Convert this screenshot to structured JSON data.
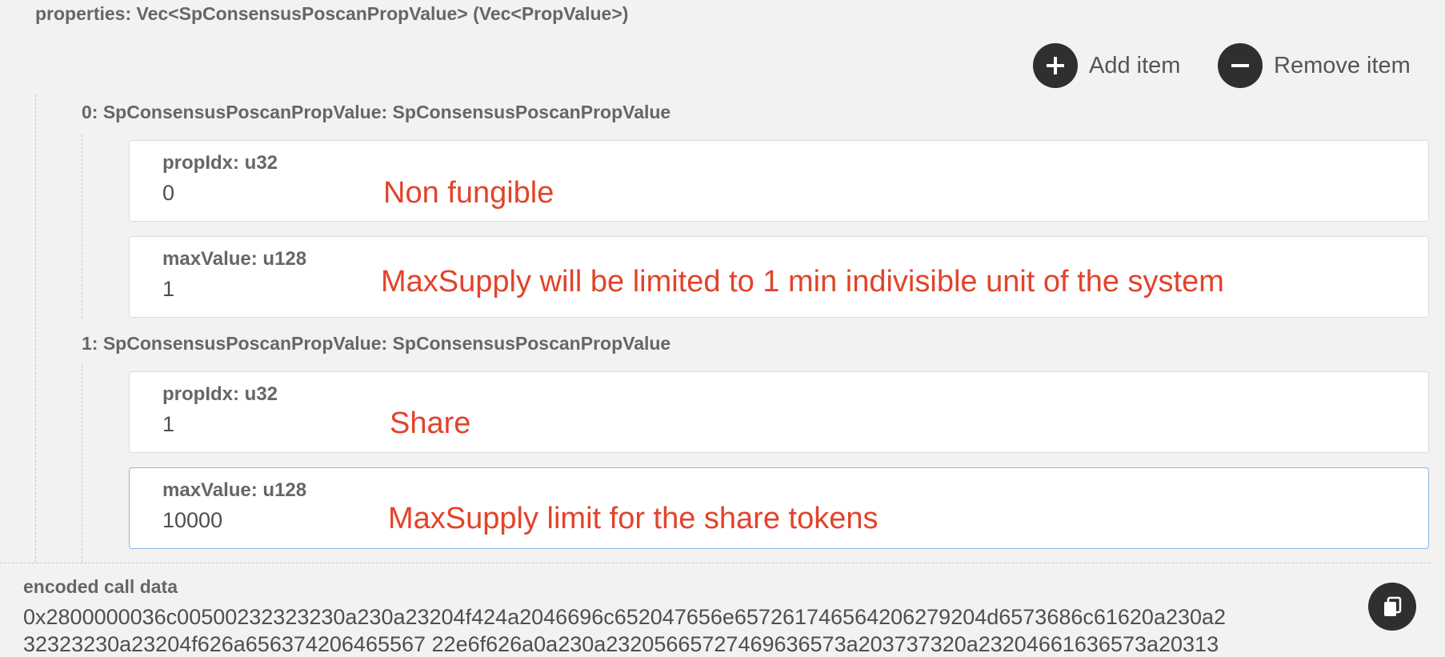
{
  "properties_label": "properties: Vec<SpConsensusPoscanPropValue> (Vec<PropValue>)",
  "buttons": {
    "add_item": "Add item",
    "remove_item": "Remove item"
  },
  "items": [
    {
      "header": "0: SpConsensusPoscanPropValue: SpConsensusPoscanPropValue",
      "prop_idx": {
        "label": "propIdx: u32",
        "value": "0",
        "note": "Non fungible"
      },
      "max_value": {
        "label": "maxValue: u128",
        "value": "1",
        "note": "MaxSupply will be limited to 1 min indivisible unit of the system"
      }
    },
    {
      "header": "1: SpConsensusPoscanPropValue: SpConsensusPoscanPropValue",
      "prop_idx": {
        "label": "propIdx: u32",
        "value": "1",
        "note": "Share"
      },
      "max_value": {
        "label": "maxValue: u128",
        "value": "10000",
        "note": "MaxSupply limit for the share tokens"
      }
    }
  ],
  "encoded_call_data": {
    "label": "encoded call data",
    "line1": "0x2800000036c00500232323230a230a23204f424a2046696c652047656e657261746564206279204d6573686c61620a230a2",
    "line2": "32323230a23204f626a656374206465567 22e6f626a0a230a23205665727469636573a203737320a23204661636573a20313"
  },
  "icons": [
    "plus-icon",
    "minus-icon",
    "copy-icon"
  ],
  "colors": {
    "annotation": "#e2432a",
    "button_bg": "#2f2f2f",
    "focus_border": "#8fb6e0",
    "background": "#f3f2f1"
  }
}
